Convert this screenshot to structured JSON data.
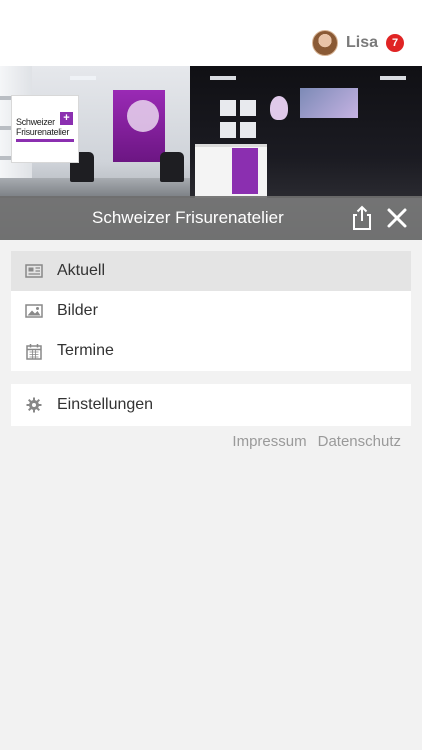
{
  "user": {
    "name": "Lisa",
    "notification_count": "7"
  },
  "business": {
    "name": "Schweizer Frisurenatelier",
    "logo_line1": "Schweizer",
    "logo_line2": "Frisurenatelier"
  },
  "menu_main": [
    {
      "label": "Aktuell",
      "icon": "newspaper-icon",
      "active": true
    },
    {
      "label": "Bilder",
      "icon": "image-icon",
      "active": false
    },
    {
      "label": "Termine",
      "icon": "calendar-icon",
      "active": false
    }
  ],
  "menu_settings": {
    "label": "Einstellungen",
    "icon": "gear-icon"
  },
  "footer": {
    "impressum": "Impressum",
    "datenschutz": "Datenschutz"
  },
  "colors": {
    "accent": "#8b2fb0",
    "badge": "#e02424",
    "bar": "#6e6e6e"
  }
}
